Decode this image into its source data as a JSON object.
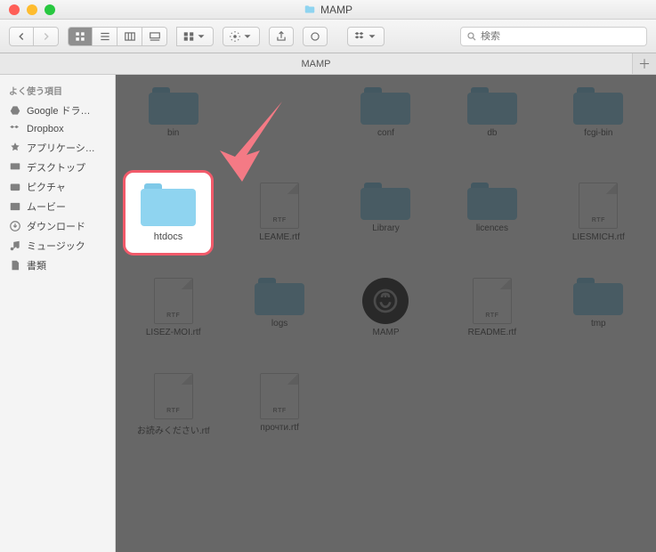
{
  "window": {
    "title": "MAMP"
  },
  "toolbar": {
    "search_placeholder": "検索"
  },
  "tabbar": {
    "tabs": [
      {
        "label": "MAMP"
      }
    ]
  },
  "sidebar": {
    "header": "よく使う項目",
    "items": [
      {
        "label": "Google ドラ…"
      },
      {
        "label": "Dropbox"
      },
      {
        "label": "アプリケーシ…"
      },
      {
        "label": "デスクトップ"
      },
      {
        "label": "ピクチャ"
      },
      {
        "label": "ムービー"
      },
      {
        "label": "ダウンロード"
      },
      {
        "label": "ミュージック"
      },
      {
        "label": "書類"
      }
    ]
  },
  "content": {
    "highlighted": {
      "name": "htdocs"
    },
    "items": [
      {
        "name": "bin",
        "kind": "folder"
      },
      {
        "name": "",
        "kind": "blank"
      },
      {
        "name": "conf",
        "kind": "folder"
      },
      {
        "name": "db",
        "kind": "folder"
      },
      {
        "name": "fcgi-bin",
        "kind": "folder"
      },
      {
        "name": "htdocs",
        "kind": "folder"
      },
      {
        "name": "LEAME.rtf",
        "kind": "rtf"
      },
      {
        "name": "Library",
        "kind": "folder"
      },
      {
        "name": "licences",
        "kind": "folder"
      },
      {
        "name": "LIESMICH.rtf",
        "kind": "rtf"
      },
      {
        "name": "LISEZ-MOI.rtf",
        "kind": "rtf"
      },
      {
        "name": "logs",
        "kind": "folder"
      },
      {
        "name": "MAMP",
        "kind": "app"
      },
      {
        "name": "README.rtf",
        "kind": "rtf"
      },
      {
        "name": "tmp",
        "kind": "folder"
      },
      {
        "name": "お読みください.rtf",
        "kind": "rtf"
      },
      {
        "name": "прочти.rtf",
        "kind": "rtf"
      }
    ]
  }
}
